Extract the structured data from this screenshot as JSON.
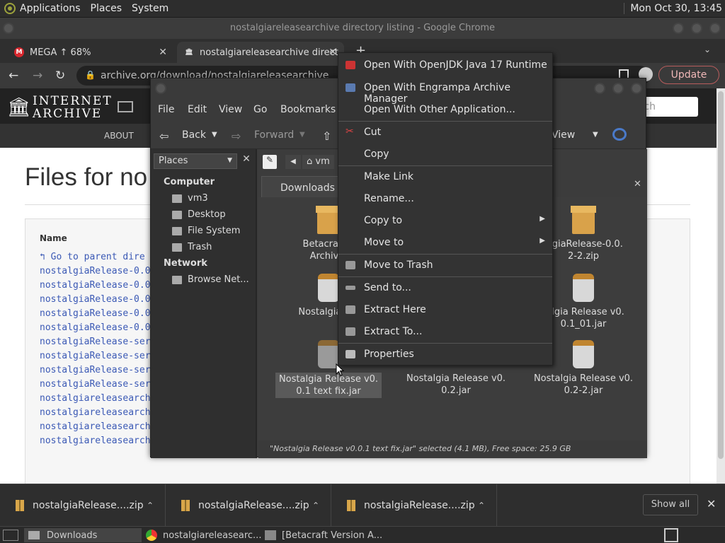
{
  "panel": {
    "menus": [
      "Applications",
      "Places",
      "System"
    ],
    "clock": "Mon Oct 30, 13:45"
  },
  "chrome": {
    "title": "nostalgiareleasearchive directory listing - Google Chrome",
    "tabs": [
      {
        "label": "MEGA ↑ 68%",
        "fav": "M",
        "fav_color": "#d9272e"
      },
      {
        "label": "nostalgiareleasearchive direct",
        "fav": "IA"
      }
    ],
    "url": "archive.org/download/nostalgiareleasearchive",
    "update_label": "Update"
  },
  "ia": {
    "logo_line1": "INTERNET",
    "logo_line2": "ARCHIVE",
    "nav_about": "ABOUT",
    "search_placeholder": "rch",
    "page_title": "Files for no",
    "table_header": "Name",
    "parent_link": "Go to parent dire",
    "links": [
      "nostalgiaRelease-0.0",
      "nostalgiaRelease-0.0",
      "nostalgiaRelease-0.0",
      "nostalgiaRelease-0.0",
      "nostalgiaRelease-0.0",
      "nostalgiaRelease-ser",
      "nostalgiaRelease-ser",
      "nostalgiaRelease-ser",
      "nostalgiaRelease-ser",
      "nostalgiareleasearch",
      "nostalgiareleasearch",
      "nostalgiareleasearch",
      "nostalgiareleasearch"
    ]
  },
  "downloads": {
    "items": [
      "nostalgiaRelease....zip",
      "nostalgiaRelease....zip",
      "nostalgiaRelease....zip"
    ],
    "show_all": "Show all"
  },
  "taskbar": {
    "items": [
      "Downloads",
      "nostalgiareleasearc...",
      "[Betacraft Version A..."
    ]
  },
  "fm": {
    "menus": [
      "File",
      "Edit",
      "View",
      "Go",
      "Bookmarks"
    ],
    "back": "Back",
    "forward": "Forward",
    "view_label": "View",
    "places_label": "Places",
    "path_label": "vm",
    "sidebar": {
      "computer_head": "Computer",
      "computer_items": [
        "vm3",
        "Desktop",
        "File System",
        "Trash"
      ],
      "network_head": "Network",
      "network_items": [
        "Browse Net..."
      ]
    },
    "tab_label": "Downloads",
    "files": [
      {
        "name": "Betacraft V\nArchive.",
        "type": "zip"
      },
      {
        "name": "algiaRelease-0.0.\n2-2.zip",
        "type": "zip"
      },
      {
        "name": "Nostalgia Rel",
        "type": "jar"
      },
      {
        "name": "talgia Release v0.\n0.1_01.jar",
        "type": "jar"
      },
      {
        "name": "Nostalgia Release v0.\n0.1 text fix.jar",
        "type": "jar",
        "selected": true
      },
      {
        "name": "Nostalgia Release v0.\n0.2.jar",
        "type": "jar"
      },
      {
        "name": "Nostalgia Release v0.\n0.2-2.jar",
        "type": "jar"
      }
    ],
    "status": "\"Nostalgia Release v0.0.1 text fix.jar\" selected (4.1 MB), Free space: 25.9 GB"
  },
  "context_menu": {
    "items": [
      {
        "label": "Open With OpenJDK Java 17 Runtime",
        "icon": "java-icon"
      },
      {
        "label": "Open With Engrampa Archive Manager",
        "icon": "archive-icon"
      },
      {
        "label": "Open With Other Application...",
        "icon": ""
      },
      {
        "label": "Cut",
        "icon": "scissors-icon"
      },
      {
        "label": "Copy",
        "icon": ""
      },
      {
        "label": "Make Link",
        "icon": ""
      },
      {
        "label": "Rename...",
        "icon": ""
      },
      {
        "label": "Copy to",
        "icon": "",
        "submenu": true
      },
      {
        "label": "Move to",
        "icon": "",
        "submenu": true
      },
      {
        "label": "Move to Trash",
        "icon": "trash-icon"
      },
      {
        "label": "Send to...",
        "icon": "send-icon"
      },
      {
        "label": "Extract Here",
        "icon": "extract-icon"
      },
      {
        "label": "Extract To...",
        "icon": "extract-icon"
      },
      {
        "label": "Properties",
        "icon": "properties-icon"
      }
    ]
  }
}
